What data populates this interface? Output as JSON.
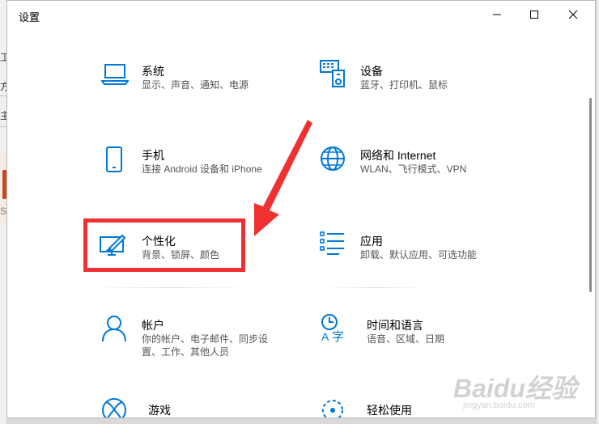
{
  "window": {
    "title": "设置"
  },
  "background_fragments": [
    "工",
    "方",
    "主",
    "S"
  ],
  "tiles": [
    {
      "id": "system",
      "icon": "laptop-icon",
      "title": "系统",
      "desc": [
        "显示、声音、通知、电源"
      ]
    },
    {
      "id": "devices",
      "icon": "keyboard-icon",
      "title": "设备",
      "desc": [
        "蓝牙、打印机、鼠标"
      ]
    },
    {
      "id": "phone",
      "icon": "phone-icon",
      "title": "手机",
      "desc": [
        "连接 Android 设备和 iPhone"
      ]
    },
    {
      "id": "network",
      "icon": "globe-icon",
      "title": "网络和 Internet",
      "desc": [
        "WLAN、飞行模式、VPN"
      ]
    },
    {
      "id": "personalization",
      "icon": "personalization-icon",
      "title": "个性化",
      "desc": [
        "背景、锁屏、颜色"
      ]
    },
    {
      "id": "apps",
      "icon": "apps-list-icon",
      "title": "应用",
      "desc": [
        "卸载、默认应用、可选功能"
      ]
    },
    {
      "id": "accounts",
      "icon": "person-icon",
      "title": "帐户",
      "desc": [
        "你的帐户、电子邮件、同步设",
        "置、工作、其他人员"
      ]
    },
    {
      "id": "time",
      "icon": "time-language-icon",
      "title": "时间和语言",
      "desc": [
        "语音、区域、日期"
      ]
    },
    {
      "id": "gaming",
      "icon": "xbox-icon",
      "title": "游戏",
      "desc": []
    },
    {
      "id": "ease",
      "icon": "ease-of-access-icon",
      "title": "轻松使用",
      "desc": []
    }
  ],
  "watermark": {
    "brand": "Baidu经验",
    "url": "jingyan.baidu.com"
  },
  "colors": {
    "accent": "#0078d7",
    "annotation": "#ef3131"
  }
}
